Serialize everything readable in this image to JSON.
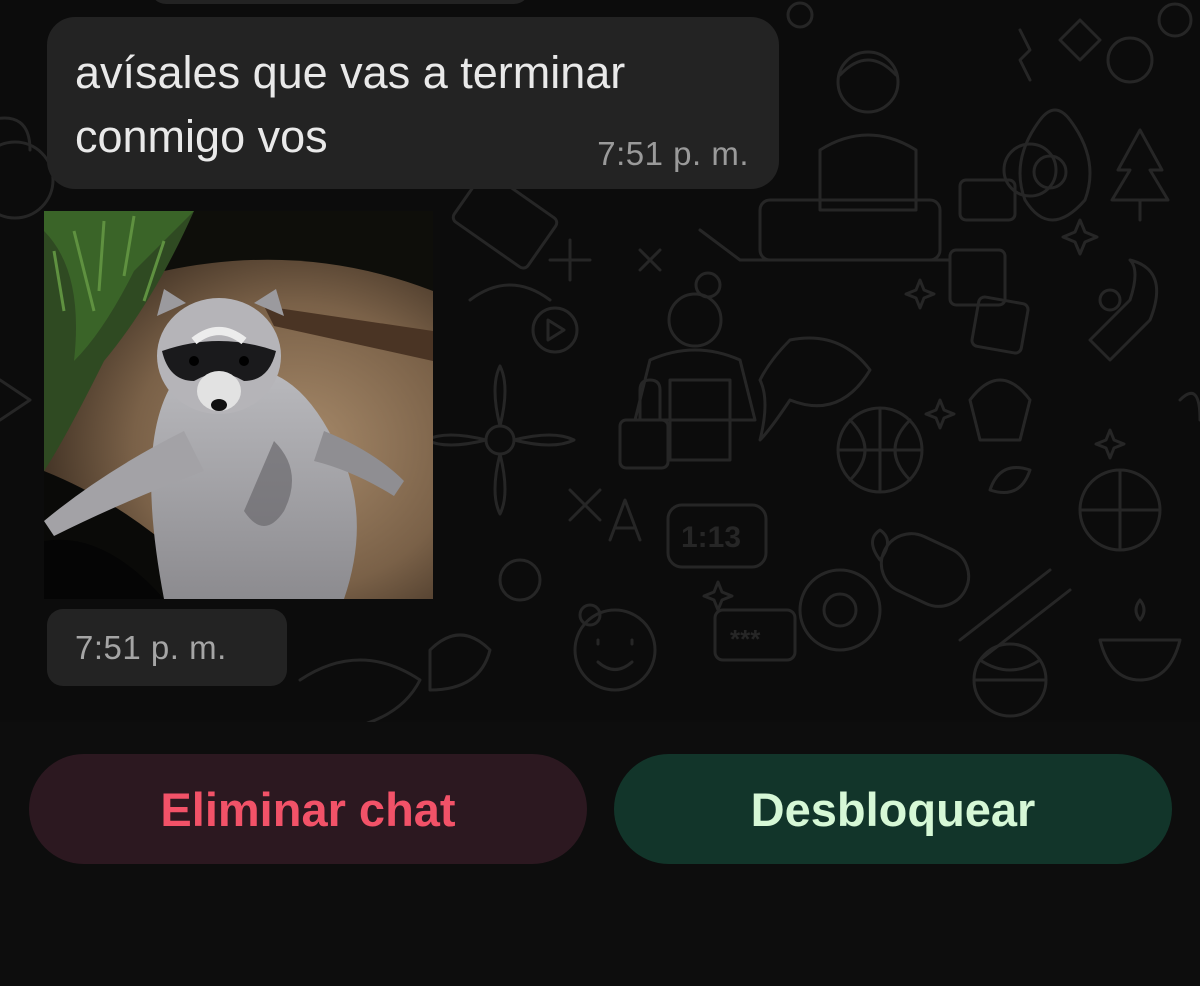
{
  "messages": [
    {
      "type": "text",
      "text": "avísales que vas a terminar\nconmigo vos",
      "time": "7:51 p. m."
    },
    {
      "type": "image",
      "image_subject": "raccoon",
      "time": "7:51 p. m."
    }
  ],
  "wallpaper": {
    "icon_text": "1:13",
    "password_text": "***",
    "pattern": "doodle"
  },
  "actions": {
    "delete_label": "Eliminar chat",
    "unblock_label": "Desbloquear"
  },
  "colors": {
    "background": "#0c0c0c",
    "bubble": "#232323",
    "delete_button_bg": "#2c1820",
    "delete_text": "#f25268",
    "unblock_button_bg": "#12352a",
    "unblock_text": "#d6f8d6"
  }
}
